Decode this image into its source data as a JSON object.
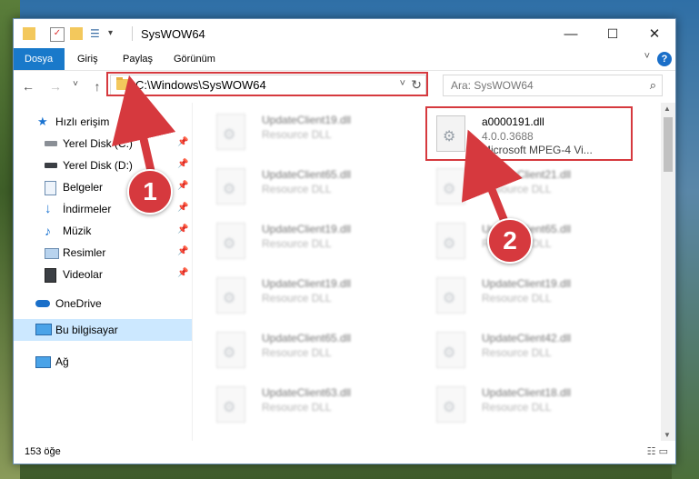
{
  "titlebar": {
    "title": "SysWOW64",
    "minimize": "—",
    "maximize": "☐",
    "close": "✕"
  },
  "ribbon": {
    "tabs": [
      "Dosya",
      "Giriş",
      "Paylaş",
      "Görünüm"
    ],
    "collapse": "˅",
    "help": "?"
  },
  "nav": {
    "back": "←",
    "forward": "→",
    "recent": "˅",
    "up": "↑"
  },
  "address": {
    "path": "C:\\Windows\\SysWOW64",
    "dropdown": "˅",
    "refresh": "↻"
  },
  "search": {
    "placeholder": "Ara: SysWOW64",
    "icon": "⌕"
  },
  "sidebar": {
    "items": [
      {
        "label": "Hızlı erişim",
        "icon": "star-icon"
      },
      {
        "label": "Yerel Disk (C:)",
        "icon": "drive-icon",
        "pinned": true
      },
      {
        "label": "Yerel Disk (D:)",
        "icon": "drive-icon",
        "pinned": true
      },
      {
        "label": "Belgeler",
        "icon": "document-icon",
        "pinned": true
      },
      {
        "label": "İndirmeler",
        "icon": "download-icon",
        "pinned": true
      },
      {
        "label": "Müzik",
        "icon": "music-icon",
        "pinned": true
      },
      {
        "label": "Resimler",
        "icon": "pictures-icon",
        "pinned": true
      },
      {
        "label": "Videolar",
        "icon": "video-icon",
        "pinned": true
      },
      {
        "label": "OneDrive",
        "icon": "cloud-icon"
      },
      {
        "label": "Bu bilgisayar",
        "icon": "computer-icon",
        "selected": true
      },
      {
        "label": "Ağ",
        "icon": "network-icon"
      }
    ],
    "pin_glyph": "📌"
  },
  "files": {
    "left": [
      {
        "name": "UpdateClient19.dll",
        "type": "Resource DLL"
      },
      {
        "name": "UpdateClient65.dll",
        "type": "Resource DLL"
      },
      {
        "name": "UpdateClient19.dll",
        "type": "Resource DLL"
      },
      {
        "name": "UpdateClient19.dll",
        "type": "Resource DLL"
      },
      {
        "name": "UpdateClient65.dll",
        "type": "Resource DLL"
      },
      {
        "name": "UpdateClient63.dll",
        "type": "Resource DLL"
      }
    ],
    "right": [
      {
        "name": "a0000191.dll",
        "version": "4.0.0.3688",
        "desc": "Microsoft MPEG-4 Vi...",
        "selected": true
      },
      {
        "name": "UpdateClient21.dll",
        "type": "Resource DLL"
      },
      {
        "name": "UpdateClient65.dll",
        "type": "Resource DLL"
      },
      {
        "name": "UpdateClient19.dll",
        "type": "Resource DLL"
      },
      {
        "name": "UpdateClient42.dll",
        "type": "Resource DLL"
      },
      {
        "name": "UpdateClient18.dll",
        "type": "Resource DLL"
      }
    ]
  },
  "status": {
    "count": "153 öğe",
    "details_view": "☷",
    "icons_view": "▭"
  },
  "annotations": {
    "step1": "1",
    "step2": "2",
    "color": "#d6393e"
  }
}
